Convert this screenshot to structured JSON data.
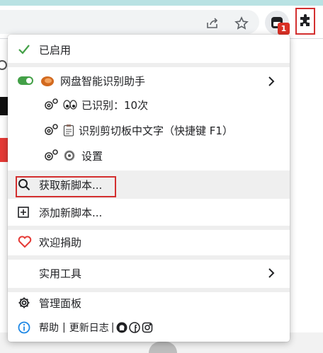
{
  "browser": {
    "extension_badge": "1",
    "icons": [
      "share-icon",
      "star-icon",
      "extension-icon",
      "puzzle-icon"
    ]
  },
  "menu": {
    "enabled_label": "已启用",
    "script": {
      "name": "网盘智能识别助手",
      "commands": [
        {
          "icon": "eyes-icon",
          "label": "已识别：10次"
        },
        {
          "icon": "clipboard-icon",
          "label": "识别剪切板中文字（快捷键 F1）"
        },
        {
          "icon": "gear-icon",
          "label": "设置"
        }
      ]
    },
    "get_new_script": "获取新脚本...",
    "add_new_script": "添加新脚本...",
    "donate": "欢迎捐助",
    "utilities": "实用工具",
    "dashboard": "管理面板",
    "footer": {
      "help": "帮助",
      "sep": "|",
      "changelog": "更新日志",
      "sep2": "|"
    }
  },
  "colors": {
    "highlight_border": "#d32f2f",
    "check": "#43a047",
    "heart": "#e53935",
    "info": "#1e88e5",
    "toggle": "#43a047"
  }
}
